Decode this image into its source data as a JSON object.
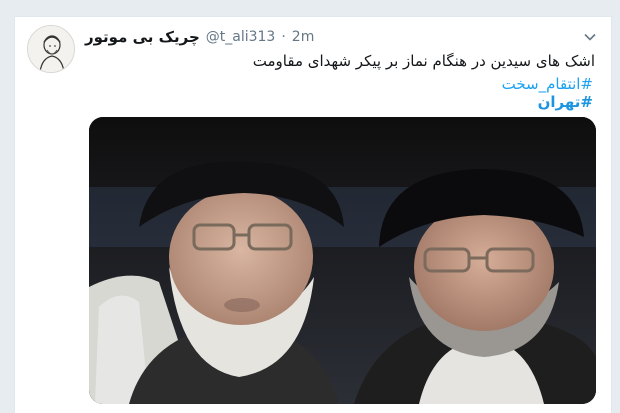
{
  "tweet": {
    "display_name": "چریک بی موتور",
    "handle": "@t_ali313",
    "separator": "·",
    "time": "2m",
    "text": "اشک های سیدین در هنگام نماز بر پیکر شهدای مقاومت",
    "hashtags": [
      "#انتقام_سخت",
      "#تهران"
    ]
  },
  "icons": {
    "menu": "chevron-down-icon",
    "avatar": "avatar-sketch"
  },
  "colors": {
    "page_background": "#e6ecf0",
    "card_background": "#ffffff",
    "text": "#14171a",
    "muted": "#657786",
    "link": "#1da1f2"
  }
}
